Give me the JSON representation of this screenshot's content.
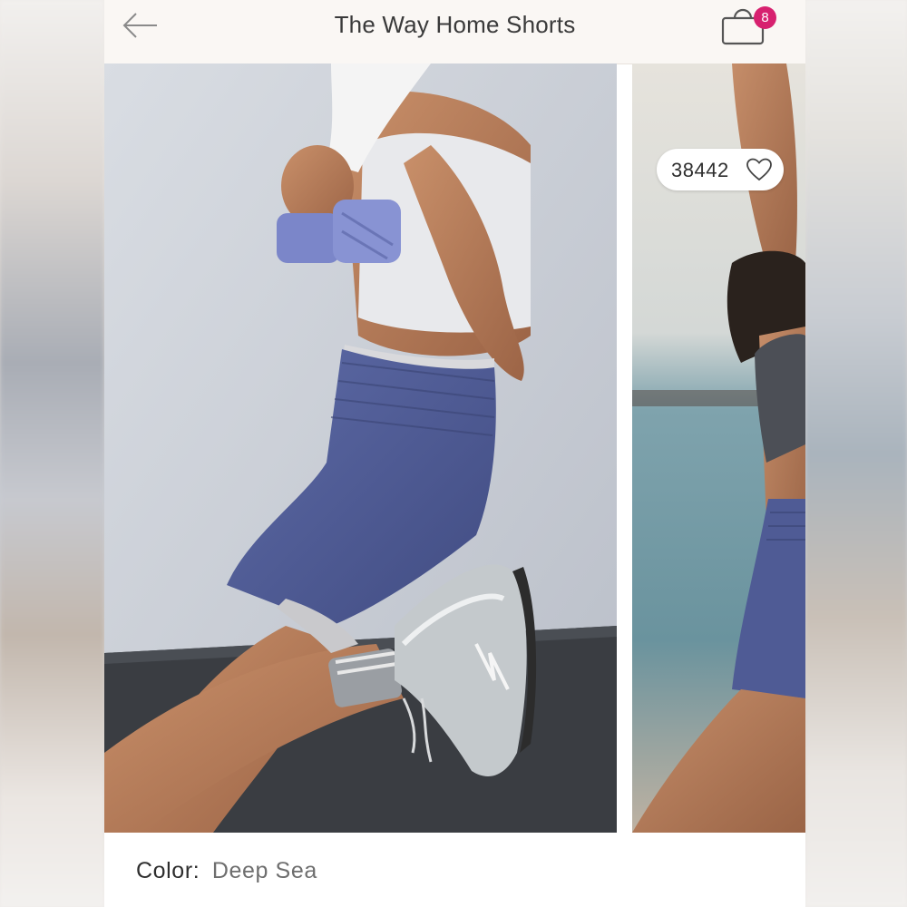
{
  "header": {
    "title": "The Way Home Shorts",
    "cart_count": "8"
  },
  "gallery": {
    "like_count": "38442"
  },
  "product": {
    "color_label": "Color:",
    "color_value": "Deep Sea"
  },
  "colors": {
    "badge": "#d7216f",
    "shorts": "#4f5b95",
    "header_bg": "#faf7f4"
  },
  "icons": [
    "back-arrow-icon",
    "shopping-bag-icon",
    "heart-icon"
  ],
  "images": [
    "Model kneeling in Deep Sea shorts, white tank, wrist weights and sneakers",
    "Model at the beach in Deep Sea shorts and grey sports bra"
  ]
}
